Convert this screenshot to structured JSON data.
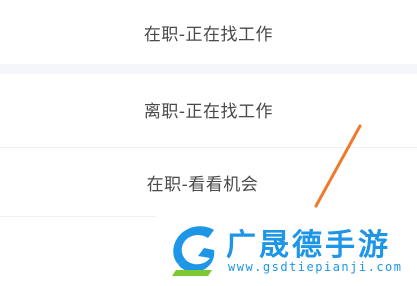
{
  "options": [
    {
      "label": "在职-正在找工作"
    },
    {
      "label": "离职-正在找工作"
    },
    {
      "label": "在职-看看机会"
    }
  ],
  "watermark": {
    "brand": "广晟德手游",
    "url": "www.gsdtiepianji.com"
  },
  "colors": {
    "option_text": "#4a4a4a",
    "pointer_line": "#f07a2a",
    "watermark_blue": "#1e96e8",
    "watermark_green": "#7cc832"
  }
}
